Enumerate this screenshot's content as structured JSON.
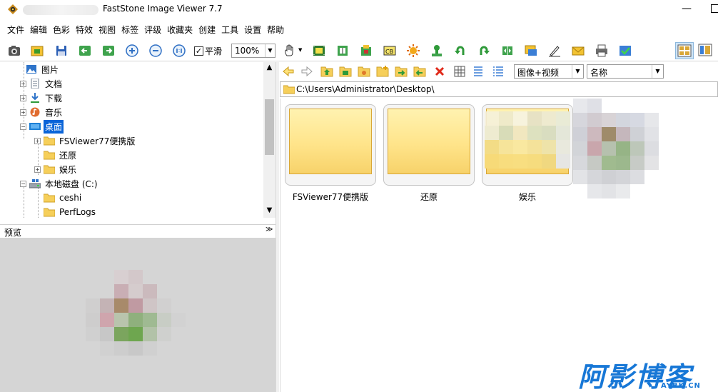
{
  "window": {
    "title": "FastStone Image Viewer 7.7",
    "minimize_glyph": "—"
  },
  "menu": [
    "文件",
    "编辑",
    "色彩",
    "特效",
    "视图",
    "标签",
    "评级",
    "收藏夹",
    "创建",
    "工具",
    "设置",
    "帮助"
  ],
  "toolbar": {
    "smooth_checkbox_label": "平滑",
    "smooth_checked": true,
    "zoom_value": "100%"
  },
  "tree": {
    "items": [
      {
        "label": "图片",
        "icon": "pictures-icon"
      },
      {
        "label": "文档",
        "icon": "documents-icon"
      },
      {
        "label": "下载",
        "icon": "download-icon"
      },
      {
        "label": "音乐",
        "icon": "music-icon"
      },
      {
        "label": "桌面",
        "icon": "desktop-icon",
        "selected": true
      },
      {
        "label": "FSViewer77便携版",
        "icon": "folder-icon"
      },
      {
        "label": "还原",
        "icon": "folder-icon"
      },
      {
        "label": "娱乐",
        "icon": "folder-icon"
      },
      {
        "label": "本地磁盘 (C:)",
        "icon": "drive-icon"
      },
      {
        "label": "ceshi",
        "icon": "folder-icon"
      },
      {
        "label": "PerfLogs",
        "icon": "folder-icon"
      }
    ]
  },
  "preview": {
    "label": "预览",
    "collapse_glyph": "≫"
  },
  "browser": {
    "filter_value": "图像+视频",
    "sort_value": "名称",
    "address": "C:\\Users\\Administrator\\Desktop\\",
    "thumbnails": [
      {
        "label": "FSViewer77便携版"
      },
      {
        "label": "还原"
      },
      {
        "label": "娱乐"
      }
    ]
  },
  "watermark": {
    "text": "阿影博客",
    "url": "AYBK.CN"
  },
  "colors": {
    "selection": "#0a64d8",
    "folder_fill": "#ffe48a",
    "watermark": "#1777d6"
  }
}
